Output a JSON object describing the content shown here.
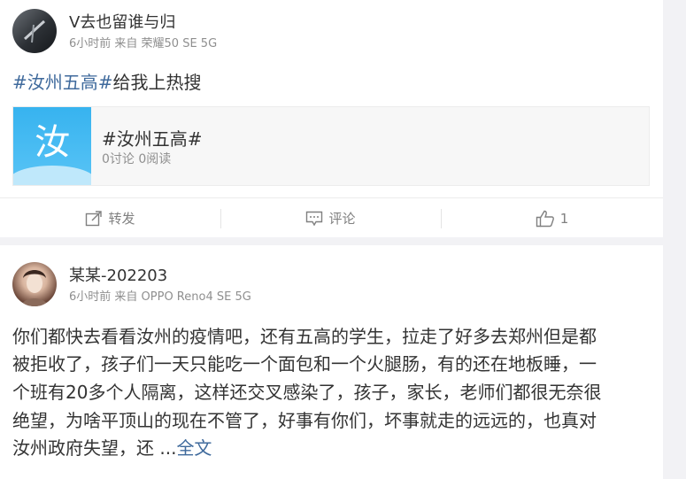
{
  "posts": [
    {
      "user": {
        "name": "V去也留谁与归"
      },
      "meta": "6小时前 来自 荣耀50 SE 5G",
      "text": {
        "hashtag": "#汝州五高#",
        "rest": "给我上热搜"
      },
      "topic_card": {
        "thumb_glyph": "汝",
        "title": "#汝州五高#",
        "stats": "0讨论 0阅读"
      },
      "actions": {
        "repost_label": "转发",
        "comment_label": "评论",
        "like_count": "1"
      }
    },
    {
      "user": {
        "name": "某某-202203"
      },
      "meta": "6小时前 来自 OPPO Reno4 SE 5G",
      "lines": [
        "你们都快去看看汝州的疫情吧，还有五高的学生，拉走了好多去郑州但是都",
        "被拒收了，孩子们一天只能吃一个面包和一个火腿肠，有的还在地板睡，一",
        "个班有20多个人隔离，这样还交叉感染了，孩子，家长，老师们都很无奈很",
        "绝望，为啥平顶山的现在不管了，好事有你们，坏事就走的远远的，也真对"
      ],
      "last_line": "汝州政府失望，还 ...",
      "full_text_link": "全文"
    }
  ],
  "colors": {
    "link": "#3f6a9c",
    "meta": "#8f8f8f",
    "page_bg": "#f2f2f5"
  }
}
